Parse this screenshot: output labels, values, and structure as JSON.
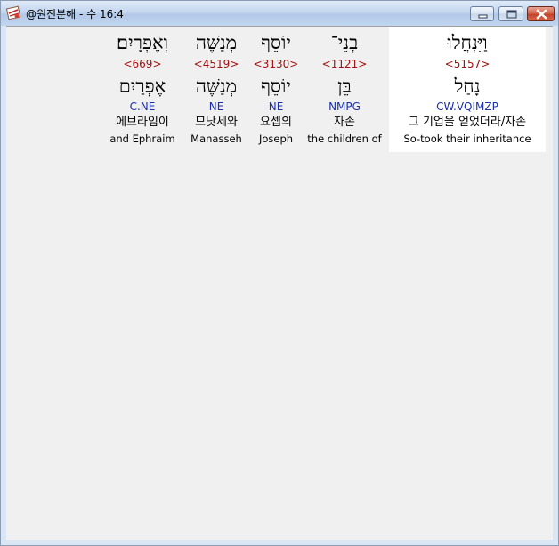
{
  "window": {
    "title": "@원전분해 - 수 16:4"
  },
  "controls": {
    "minimize_icon": "minimize-icon",
    "maximize_icon": "maximize-icon",
    "close_icon": "close-icon"
  },
  "colors": {
    "strong_number": "#a01010",
    "morphology": "#1a2fa8",
    "selection_background": "#ffffff",
    "client_background": "#f0f0f0"
  },
  "words": [
    {
      "hebrew": "וַיִּנְחֲלוּ",
      "strong": "<5157>",
      "lemma": "נָחַל",
      "morph": "CW.VQIMZP",
      "korean": "그 기업을 얻었더라/자손",
      "english": "So-took their inheritance",
      "selected": true
    },
    {
      "hebrew": "בְנֵי־",
      "strong": "<1121>",
      "lemma": "בֵּן",
      "morph": "NMPG",
      "korean": "자손",
      "english": "the children of",
      "selected": false
    },
    {
      "hebrew": "יוֹסֵף",
      "strong": "<3130>",
      "lemma": "יוֹסֵף",
      "morph": "NE",
      "korean": "요셉의",
      "english": "Joseph",
      "selected": false
    },
    {
      "hebrew": "מְנַשֶּׁה",
      "strong": "<4519>",
      "lemma": "מְנַשֶּׁה",
      "morph": "NE",
      "korean": "므낫세와",
      "english": "Manasseh",
      "selected": false
    },
    {
      "hebrew": "וְאֶפְרָיִם׃",
      "strong": "<669>",
      "lemma": "אֶפְרַיִם",
      "morph": "C.NE",
      "korean": "에브라임이",
      "english": "and Ephraim",
      "selected": false
    }
  ]
}
